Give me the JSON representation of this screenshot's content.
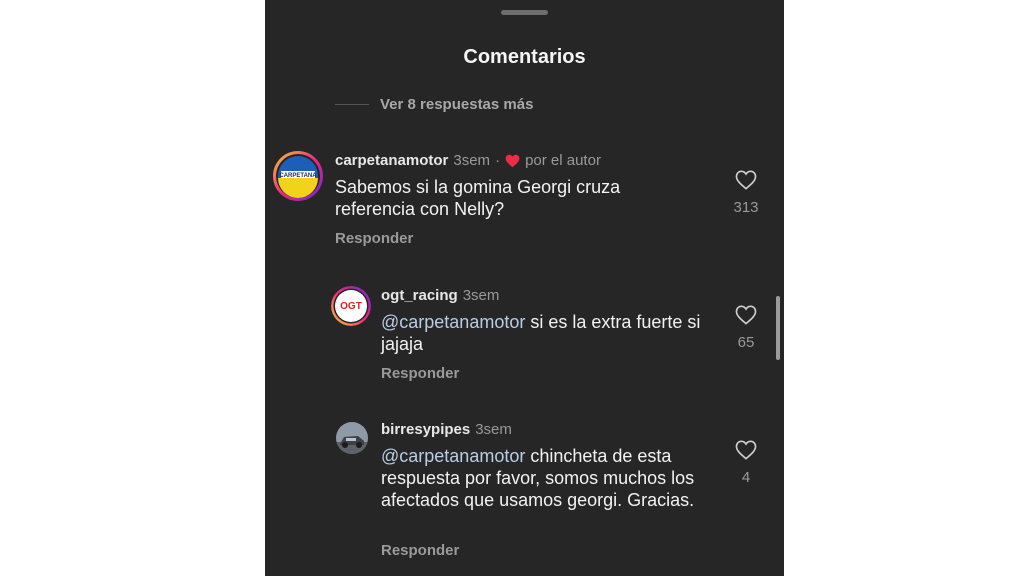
{
  "header": {
    "title": "Comentarios"
  },
  "thread": {
    "more_replies": "Ver 8 respuestas más"
  },
  "comments": [
    {
      "username": "carpetanamotor",
      "time": "3sem",
      "separator": "·",
      "liked_by_author": "por el autor",
      "text": "Sabemos si la gomina Georgi cruza referencia con Nelly?",
      "reply_label": "Responder",
      "likes": "313",
      "avatar_text": "CARPETANA"
    },
    {
      "username": "ogt_racing",
      "time": "3sem",
      "mention": "@carpetanamotor",
      "text": " si es la extra fuerte si jajaja",
      "reply_label": "Responder",
      "likes": "65",
      "avatar_text": "OGT"
    },
    {
      "username": "birresypipes",
      "time": "3sem",
      "mention": "@carpetanamotor",
      "text": " chincheta de esta respuesta por favor, somos muchos los afectados que usamos georgi. Gracias.",
      "reply_label": "Responder",
      "likes": "4"
    }
  ],
  "colors": {
    "background": "#262626",
    "text": "#f2f2f2",
    "muted": "#9a9a9a",
    "mention": "#b9cde4",
    "heart_red": "#ed2c45"
  },
  "icons": {
    "like": "heart-outline-icon",
    "author_like": "heart-filled-icon"
  }
}
